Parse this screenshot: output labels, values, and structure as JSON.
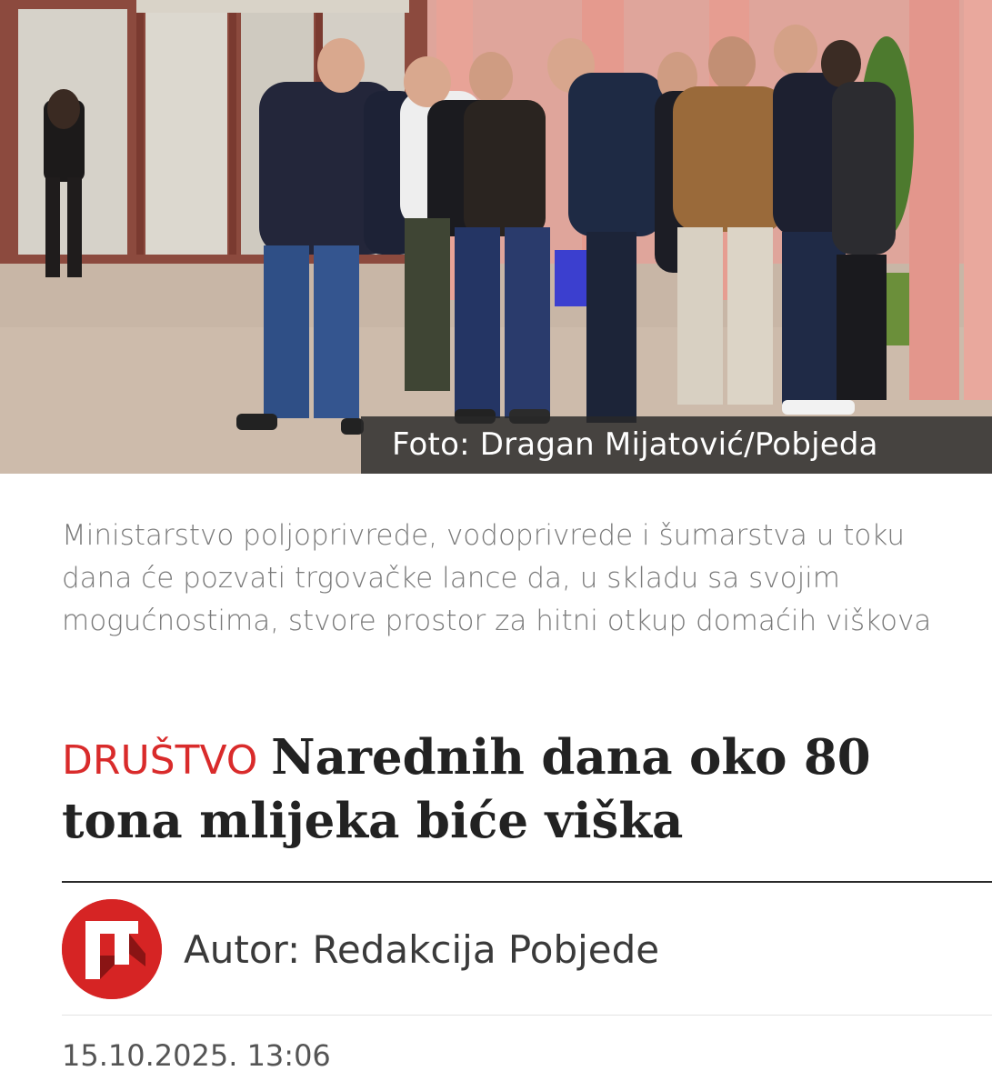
{
  "hero": {
    "photo_credit": "Foto: Dragan Mijatović/Pobjeda"
  },
  "article": {
    "lead": "Ministarstvo poljoprivrede, vodoprivrede i šumarstva u toku dana će pozvati trgovačke lance da, u skladu sa svojim mogućnostima, stvore prostor za hitni otkup domaćih viškova",
    "category": "DRUŠTVO",
    "title": "Narednih dana oko 80 tona mlijeka biće viška",
    "author": "Autor: Redakcija Pobjede",
    "date": "15.10.2025. 13:06"
  },
  "colors": {
    "category": "#d92b2b",
    "logo": "#d62424",
    "pillars": "#e3968c"
  },
  "icons": {
    "publisher_logo": "pobjeda-logo-icon"
  }
}
